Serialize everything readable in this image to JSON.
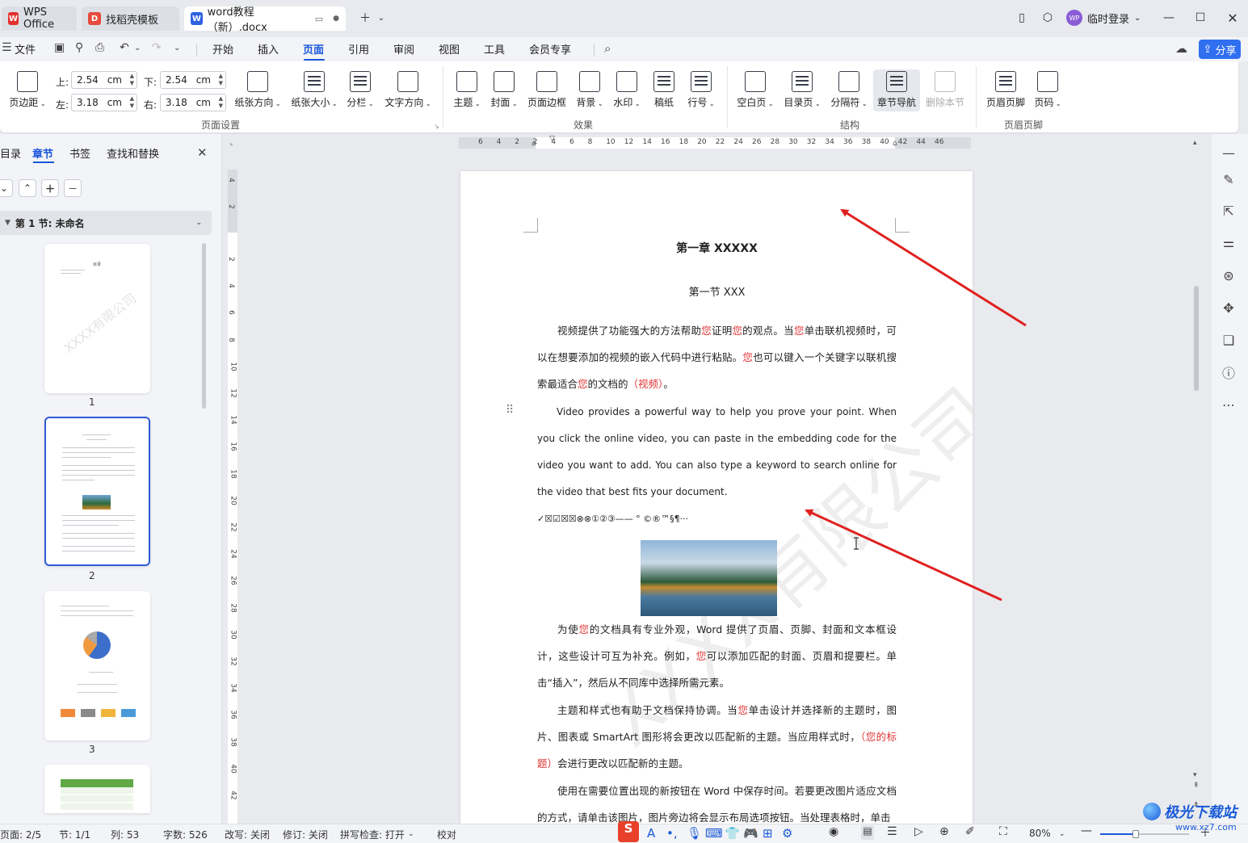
{
  "titlebar": {
    "tabs": [
      {
        "label": "WPS Office",
        "active": false
      },
      {
        "label": "找稻壳模板",
        "active": false
      },
      {
        "label": "word教程（新）.docx",
        "active": true
      }
    ],
    "login_label": "临时登录",
    "avatar_text": "WP"
  },
  "menubar": {
    "file_label": "文件",
    "items": [
      "开始",
      "插入",
      "页面",
      "引用",
      "审阅",
      "视图",
      "工具",
      "会员专享"
    ],
    "active": "页面",
    "share_label": "分享"
  },
  "ribbon": {
    "margins_label": "页边距",
    "top_label": "上:",
    "top_value": "2.54",
    "bottom_label": "下:",
    "bottom_value": "2.54",
    "left_label": "左:",
    "left_value": "3.18",
    "right_label": "右:",
    "right_value": "3.18",
    "unit": "cm",
    "orientation_label": "纸张方向",
    "size_label": "纸张大小",
    "columns_label": "分栏",
    "text_dir_label": "文字方向",
    "group_page_setup": "页面设置",
    "theme_label": "主题",
    "cover_label": "封面",
    "border_label": "页面边框",
    "background_label": "背景",
    "watermark_label": "水印",
    "manuscript_label": "稿纸",
    "line_num_label": "行号",
    "group_effects": "效果",
    "blank_page_label": "空白页",
    "toc_page_label": "目录页",
    "separator_label": "分隔符",
    "chapter_nav_label": "章节导航",
    "delete_section_label": "删除本节",
    "group_structure": "结构",
    "header_footer_label": "页眉页脚",
    "page_num_label": "页码",
    "group_header_footer": "页眉页脚"
  },
  "leftpanel": {
    "tabs": [
      "目录",
      "章节",
      "书签",
      "查找和替换"
    ],
    "active_tab": "章节",
    "section_title": "第 1 节: 未命名",
    "thumb_numbers": [
      "1",
      "2",
      "3"
    ],
    "thumb1_title": "目录",
    "watermark_text": "XXXX有限公司"
  },
  "hruler_numbers": [
    "6",
    "4",
    "2",
    "2",
    "4",
    "6",
    "8",
    "10",
    "12",
    "14",
    "16",
    "18",
    "20",
    "22",
    "24",
    "26",
    "28",
    "30",
    "32",
    "34",
    "36",
    "38",
    "40",
    "42",
    "44",
    "46"
  ],
  "vruler_numbers": [
    "4",
    "2",
    "2",
    "4",
    "6",
    "8",
    "10",
    "12",
    "14",
    "16",
    "18",
    "20",
    "22",
    "24",
    "26",
    "28",
    "30",
    "32",
    "34",
    "36",
    "38",
    "40",
    "42"
  ],
  "document": {
    "chapter_title": "第一章  XXXXX",
    "section_title": "第一节  XXX",
    "p1_parts": [
      "视频提供了功能强大的方法帮助",
      "您",
      "证明",
      "您",
      "的观点。当",
      "您",
      "单击联机视频时，可以在想要添加的视频的嵌入代码中进行粘贴。",
      "您",
      "也可以键入一个关键字以联机搜索最适合",
      "您",
      "的文档的",
      "（视频）",
      "。"
    ],
    "p2": "Video provides a powerful way to help you prove your point. When you click the online video, you can paste in the embedding code for the video you want to add. You can also type a keyword to search online for the video that best fits your document.",
    "symbols": "✓☒☑☒☒⊗⊗①②③——    °  ©®™§¶···",
    "p3_parts": [
      "为使",
      "您",
      "的文档具有专业外观，Word 提供了页眉、页脚、封面和文本框设计，这些设计可互为补充。例如，",
      "您",
      "可以添加匹配的封面、页眉和提要栏。单击“插入”，然后从不同库中选择所需元素。"
    ],
    "p4_parts": [
      "主题和样式也有助于文档保持协调。当",
      "您",
      "单击设计并选择新的主题时，图片、图表或 SmartArt 图形将会更改以匹配新的主题。当应用样式时，",
      "（您的标题）",
      "会进行更改以匹配新的主题。"
    ],
    "p5": "使用在需要位置出现的新按钮在 Word 中保存时间。若要更改图片适应文档的方式，请单击该图片，图片旁边将会显示布局选项按钮。当处理表格时，单击",
    "watermark": "XXXX有限公司"
  },
  "statusbar": {
    "page": "页面: 2/5",
    "section": "节: 1/1",
    "column": "列: 53",
    "words": "字数: 526",
    "overtype": "改写: 关闭",
    "revision": "修订: 关闭",
    "spellcheck": "拼写检查: 打开",
    "proofread": "校对",
    "zoom": "80%"
  },
  "site_watermark": {
    "name": "极光下载站",
    "url": "www.xz7.com"
  },
  "colors": {
    "accent": "#1a56db",
    "red_arrow": "#e02020",
    "red_text": "#e03434"
  }
}
